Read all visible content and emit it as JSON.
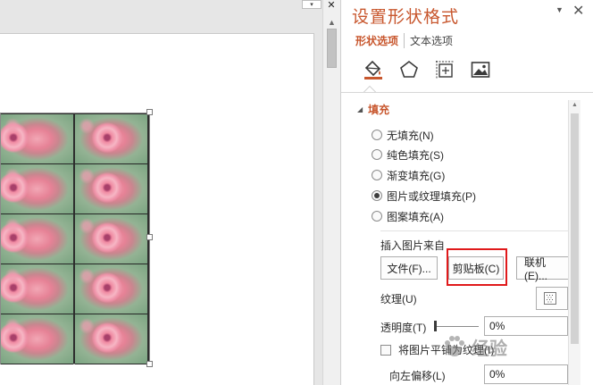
{
  "pane": {
    "title": "设置形状格式",
    "tabs": [
      {
        "label": "形状选项"
      },
      {
        "label": "文本选项"
      }
    ],
    "category_icons": [
      "fill-line-icon",
      "effects-pentagon-icon",
      "size-properties-icon",
      "picture-icon"
    ],
    "section": {
      "title": "填充",
      "fill_options": [
        {
          "label": "无填充(N)",
          "checked": false
        },
        {
          "label": "纯色填充(S)",
          "checked": false
        },
        {
          "label": "渐变填充(G)",
          "checked": false
        },
        {
          "label": "图片或纹理填充(P)",
          "checked": true
        },
        {
          "label": "图案填充(A)",
          "checked": false
        }
      ],
      "insert_from_label": "插入图片来自",
      "buttons": {
        "file": "文件(F)...",
        "clipboard": "剪贴板(C)",
        "online": "联机(E)..."
      },
      "texture_label": "纹理(U)",
      "transparency_label": "透明度(T)",
      "transparency_value": "0%",
      "tile_checkbox_label": "将图片平铺为纹理(I)",
      "tile_checked": false,
      "offset_left_label": "向左偏移(L)",
      "offset_left_value": "0%"
    }
  },
  "watermark": {
    "text": "经验"
  },
  "colors": {
    "accent": "#c8572e",
    "highlight": "#e0191b"
  }
}
